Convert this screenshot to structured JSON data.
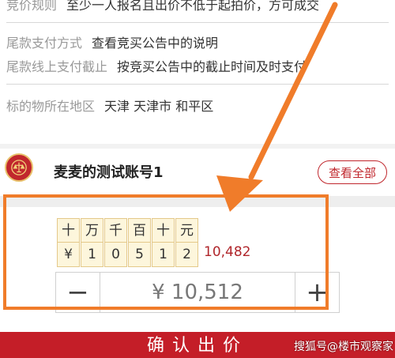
{
  "info": {
    "rows": [
      {
        "label": "竞价规则",
        "value": "至少一人报名且出价不低于起拍价，方可成交"
      },
      {
        "label": "尾款支付方式",
        "value": "查看竞买公告中的说明"
      },
      {
        "label": "尾款线上支付截止",
        "value": "按竞买公告中的截止时间及时支付"
      },
      {
        "label": "标的物所在地区",
        "value": "天津 天津市 和平区"
      }
    ]
  },
  "bidder": {
    "name": "麦麦的测试账号1",
    "view_all": "查看全部"
  },
  "bid": {
    "units": [
      "十",
      "万",
      "千",
      "百",
      "十",
      "元"
    ],
    "digits": [
      "¥",
      "1",
      "0",
      "5",
      "1",
      "2"
    ],
    "amount_text": "10,482",
    "stepper_minus": "−",
    "stepper_value": "¥ 10,512",
    "stepper_plus": "+"
  },
  "confirm": {
    "label": "确认出价"
  },
  "watermark": {
    "text": "搜狐号@楼市观察家"
  },
  "colors": {
    "accent_red": "#c41e28",
    "highlight_orange": "#f07c2a",
    "digit_bg": "#fdf6dc"
  },
  "icons": {
    "emblem": "court-emblem-icon",
    "arrow": "pointer-arrow"
  }
}
